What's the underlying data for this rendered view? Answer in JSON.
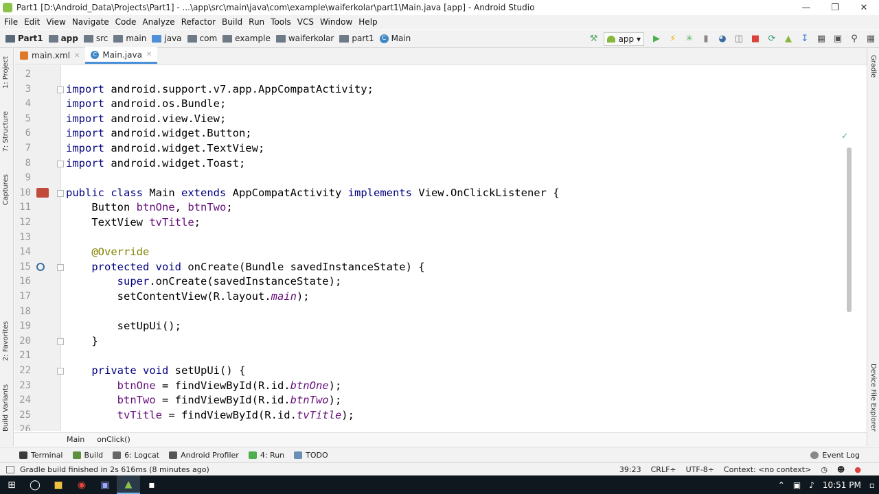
{
  "window": {
    "title": "Part1 [D:\\Android_Data\\Projects\\Part1] - ...\\app\\src\\main\\java\\com\\example\\waiferkolar\\part1\\Main.java [app] - Android Studio"
  },
  "menu": [
    "File",
    "Edit",
    "View",
    "Navigate",
    "Code",
    "Analyze",
    "Refactor",
    "Build",
    "Run",
    "Tools",
    "VCS",
    "Window",
    "Help"
  ],
  "breadcrumbs": [
    "Part1",
    "app",
    "src",
    "main",
    "java",
    "com",
    "example",
    "waiferkolar",
    "part1",
    "Main"
  ],
  "run_config": "app",
  "tabs": [
    {
      "label": "main.xml",
      "active": false
    },
    {
      "label": "Main.java",
      "active": true
    }
  ],
  "left_tool_tabs": [
    "1: Project",
    "7: Structure",
    "Captures",
    "2: Favorites",
    "Build Variants"
  ],
  "right_tool_tabs": [
    "Gradle",
    "Device File Explorer"
  ],
  "code_lines": [
    {
      "n": "2",
      "t": ""
    },
    {
      "n": "3",
      "t": "import android.support.v7.app.AppCompatActivity;"
    },
    {
      "n": "4",
      "t": "import android.os.Bundle;"
    },
    {
      "n": "5",
      "t": "import android.view.View;"
    },
    {
      "n": "6",
      "t": "import android.widget.Button;"
    },
    {
      "n": "7",
      "t": "import android.widget.TextView;"
    },
    {
      "n": "8",
      "t": "import android.widget.Toast;"
    },
    {
      "n": "9",
      "t": ""
    },
    {
      "n": "10",
      "t": "public class Main extends AppCompatActivity implements View.OnClickListener {"
    },
    {
      "n": "11",
      "t": "    Button btnOne, btnTwo;"
    },
    {
      "n": "12",
      "t": "    TextView tvTitle;"
    },
    {
      "n": "13",
      "t": ""
    },
    {
      "n": "14",
      "t": "    @Override"
    },
    {
      "n": "15",
      "t": "    protected void onCreate(Bundle savedInstanceState) {"
    },
    {
      "n": "16",
      "t": "        super.onCreate(savedInstanceState);"
    },
    {
      "n": "17",
      "t": "        setContentView(R.layout.main);"
    },
    {
      "n": "18",
      "t": ""
    },
    {
      "n": "19",
      "t": "        setUpUi();"
    },
    {
      "n": "20",
      "t": "    }"
    },
    {
      "n": "21",
      "t": ""
    },
    {
      "n": "22",
      "t": "    private void setUpUi() {"
    },
    {
      "n": "23",
      "t": "        btnOne = findViewById(R.id.btnOne);"
    },
    {
      "n": "24",
      "t": "        btnTwo = findViewById(R.id.btnTwo);"
    },
    {
      "n": "25",
      "t": "        tvTitle = findViewById(R.id.tvTitle);"
    },
    {
      "n": "26",
      "t": ""
    }
  ],
  "editor_breadcrumb": [
    "Main",
    "onClick()"
  ],
  "tool_windows": [
    "Terminal",
    "Build",
    "6: Logcat",
    "Android Profiler",
    "4: Run",
    "TODO"
  ],
  "event_log": "Event Log",
  "status": {
    "message": "Gradle build finished in 2s 616ms (8 minutes ago)",
    "position": "39:23",
    "line_sep": "CRLF÷",
    "encoding": "UTF-8÷",
    "context": "Context: <no context>"
  },
  "taskbar": {
    "clock": "10:51 PM"
  }
}
